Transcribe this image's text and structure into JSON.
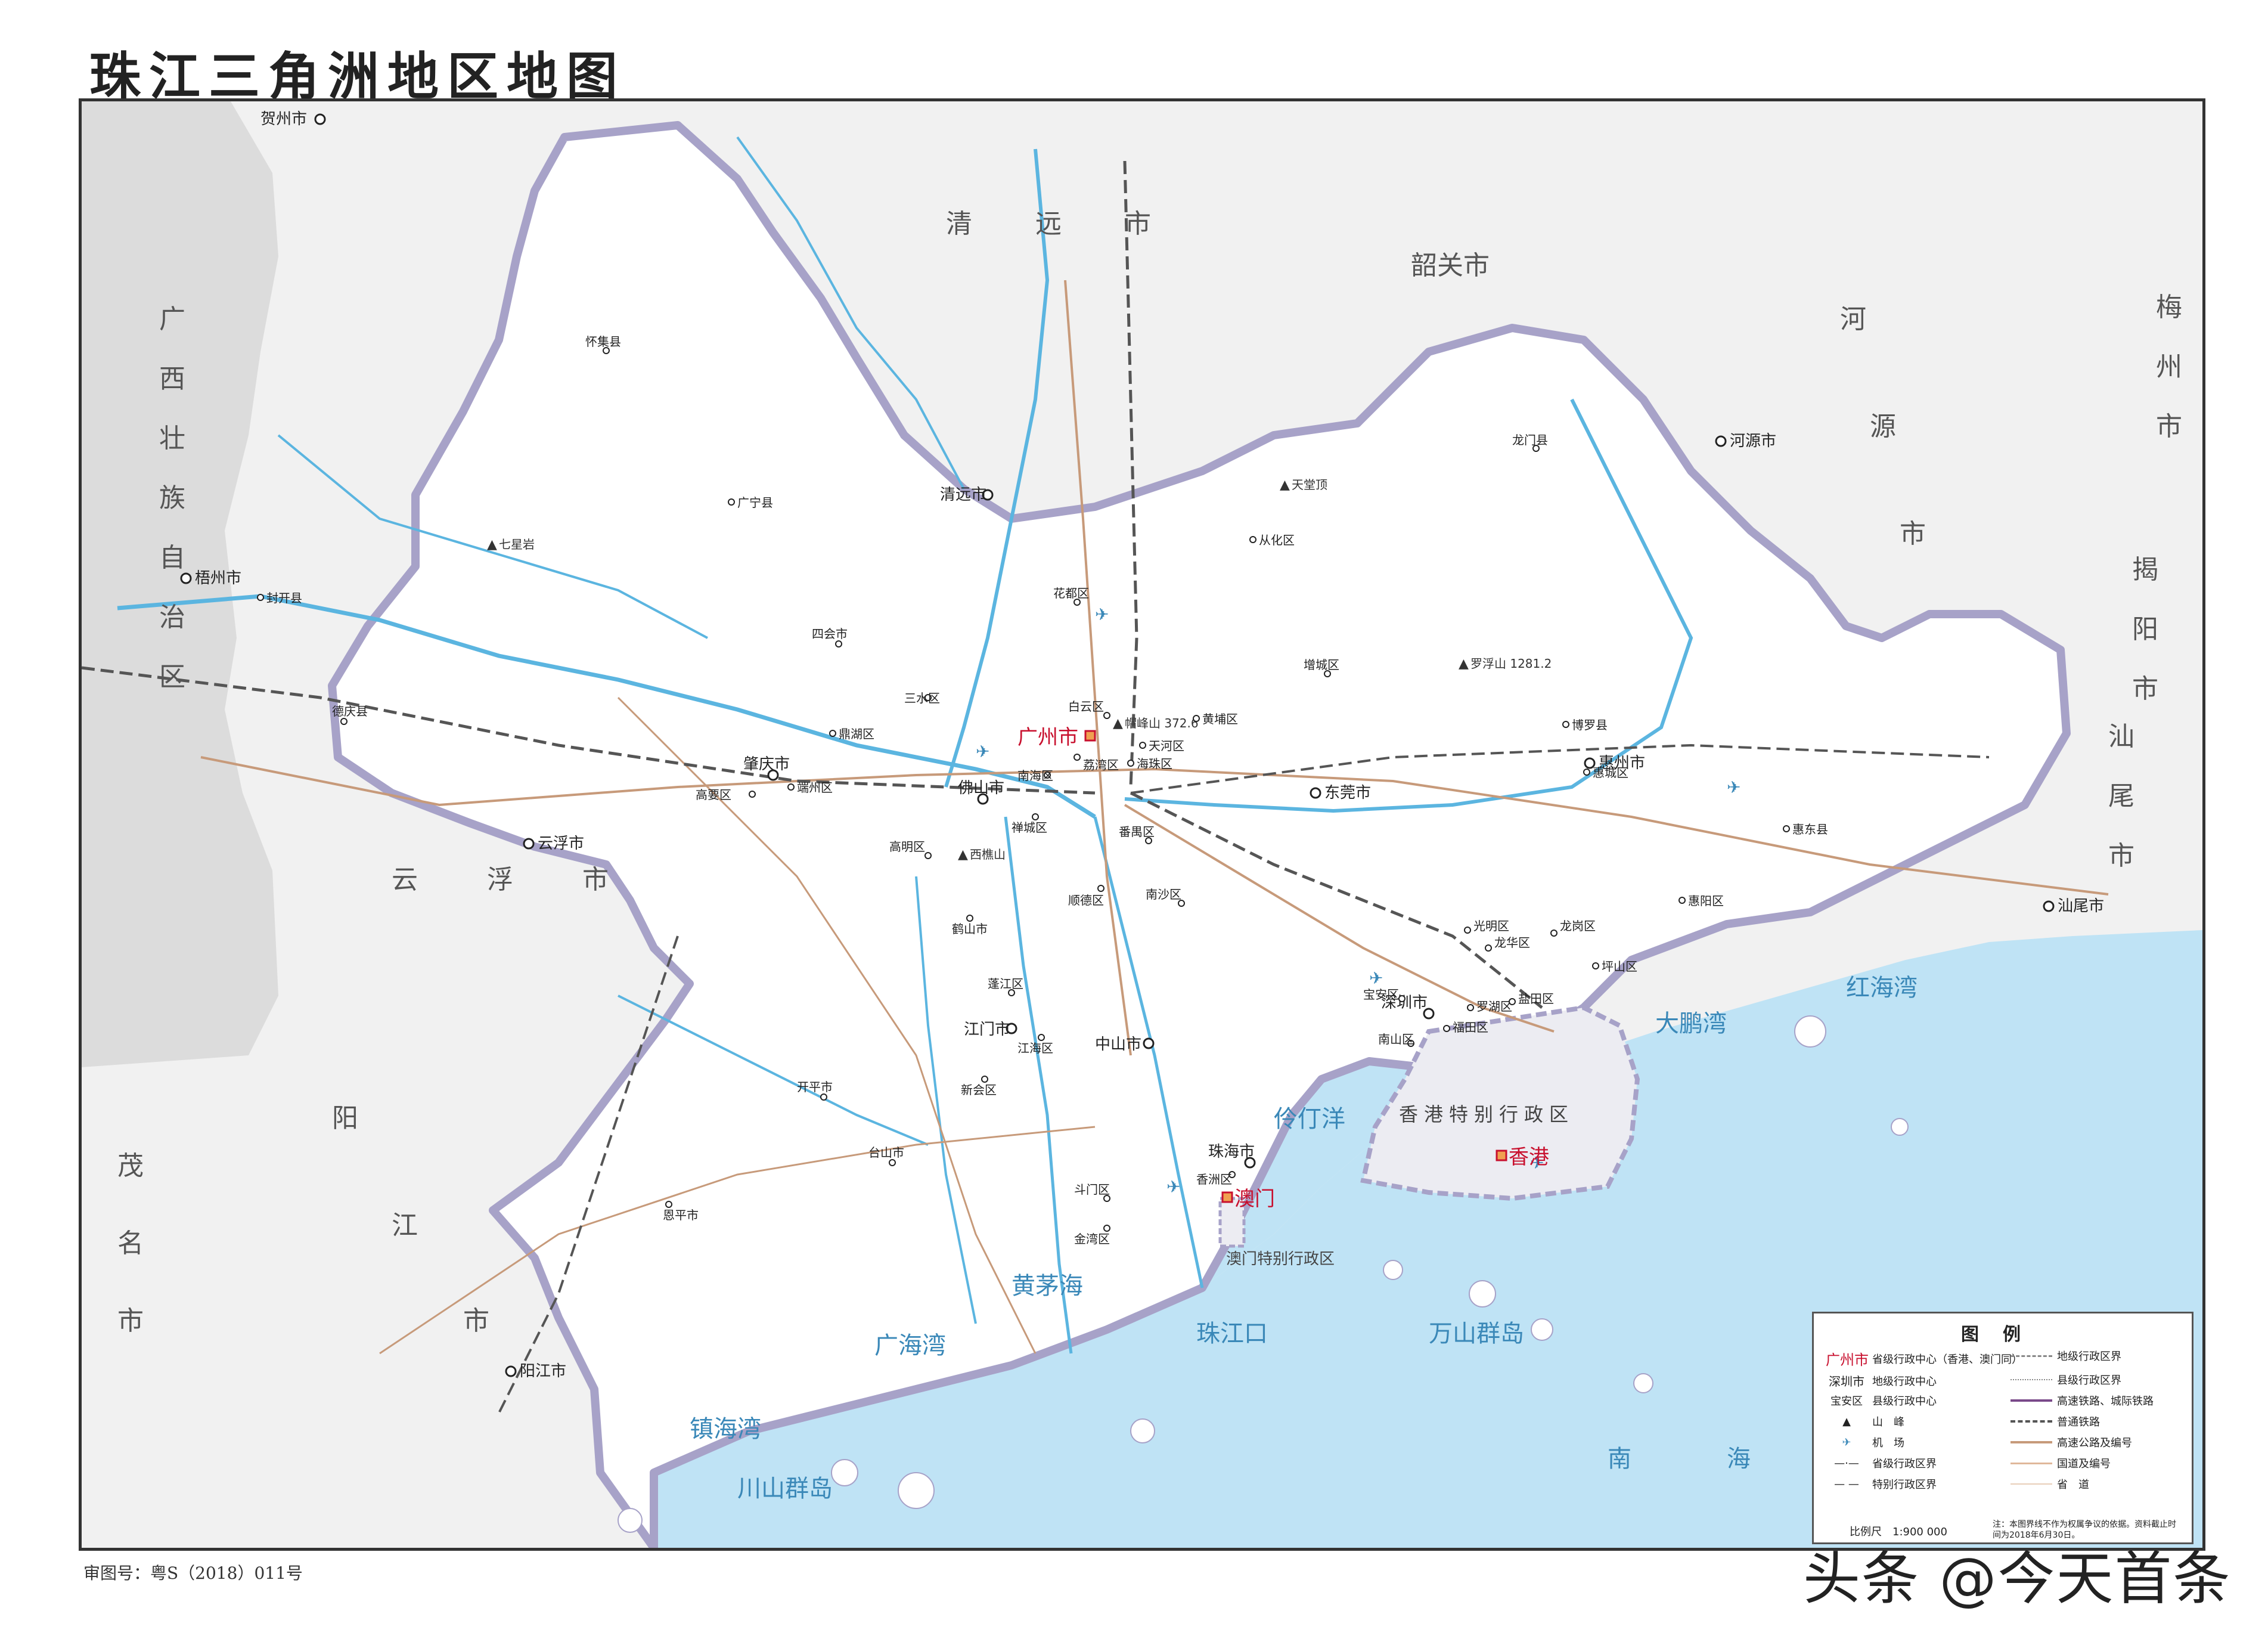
{
  "title": "珠江三角洲地区地图",
  "review_number": "审图号：粤S（2018）011号",
  "watermark": "头条 @今天首条",
  "colors": {
    "sea": "#bfe3f5",
    "region_fill": "#ffffff",
    "outside_fill": "#f1f1f1",
    "guangxi_fill": "#dcdcdc",
    "boundary": "#a7a2c8",
    "river": "#5bb5e0",
    "road": "#c79a7a",
    "rail": "#555555",
    "hk_fill": "#ececf2",
    "capital": "#c8102e"
  },
  "cities": {
    "guangzhou": "广州市",
    "shenzhen": "深圳市",
    "hongkong": "香港",
    "macau": "澳门",
    "foshan": "佛山市",
    "dongguan": "东莞市",
    "zhongshan": "中山市",
    "zhuhai": "珠海市",
    "jiangmen": "江门市",
    "zhaoqing": "肇庆市",
    "huizhou": "惠州市",
    "qingyuan": "清远市",
    "heyuan": "河源市",
    "yunfu": "云浮市",
    "wuzhou": "梧州市",
    "hezhou": "贺州市",
    "shanwei": "汕尾市",
    "yangjiang": "阳江市",
    "kaiping": "开平市",
    "taishan": "台山市",
    "enping": "恩平市",
    "sihui": "四会市",
    "huaiji": "怀集县",
    "guangning": "广宁县",
    "fengkai": "封开县",
    "deqing": "德庆县",
    "longmen": "龙门县",
    "boluo": "博罗县",
    "huidong": "惠东县",
    "conghua": "从化区",
    "huadu": "花都区",
    "baiyun": "白云区",
    "huangpu": "黄埔区",
    "zengcheng": "增城区",
    "tianhe": "天河区",
    "liwan": "荔湾区",
    "haizhu": "海珠区",
    "panyu": "番禺区",
    "nansha": "南沙区",
    "nanhai": "南海区",
    "chancheng": "禅城区",
    "sanshui": "三水区",
    "gaoming": "高明区",
    "shunde": "顺德区",
    "heshan": "鹤山市",
    "pengjiang": "蓬江区",
    "jianghai": "江海区",
    "xinhui": "新会区",
    "doumen": "斗门区",
    "jinwan": "金湾区",
    "xiangzhou": "香洲区",
    "dinghu": "鼎湖区",
    "duanzhou": "端州区",
    "gaoyao": "高要区",
    "huiyang": "惠阳区",
    "huicheng": "惠城区",
    "longgang": "龙岗区",
    "pingshan": "坪山区",
    "guangming": "光明区",
    "longhua": "龙华区",
    "baoan": "宝安区",
    "nanshan": "南山区",
    "futian": "福田区",
    "luohu": "罗湖区",
    "yantian": "盐田区"
  },
  "outside_labels": {
    "guangxi": [
      "广",
      "西",
      "壮",
      "族",
      "自",
      "治",
      "区"
    ],
    "shaoguan": "韶关市",
    "qingyuan_big": [
      "清",
      "远",
      "市"
    ],
    "heyuan_big": [
      "河",
      "源",
      "市"
    ],
    "yunfu_big": [
      "云",
      "浮",
      "市"
    ],
    "yangjiang_big": [
      "阳",
      "江",
      "市"
    ],
    "maoming_big": [
      "茂",
      "名",
      "市"
    ],
    "meizhou_big": [
      "梅",
      "州",
      "市"
    ],
    "shanwei_big": [
      "汕",
      "尾",
      "市"
    ],
    "jieyang_big": [
      "揭",
      "阳",
      "市"
    ],
    "hk_sar": "香港特别行政区",
    "macau_sar": "澳门特别行政区"
  },
  "sea_labels": {
    "south_sea": "南　　　　海",
    "pearl_mouth": "珠江口",
    "wanshan": "万山群岛",
    "chuanshan": "川山群岛",
    "lingding": "伶仃洋",
    "huangmao": "黄茅海",
    "guanghai": "广海湾",
    "zhenhai": "镇海湾",
    "honghai": "红海湾",
    "dapeng": "大鹏湾"
  },
  "peaks": {
    "baiyun_peak": "帽峰山 372.6",
    "luofu": "罗浮山 1281.2",
    "xiqiao": "西樵山",
    "qixing": "七星岩",
    "tiantang": "天堂顶"
  },
  "legend": {
    "title": "图例",
    "items": [
      {
        "symbol": "广州市",
        "label": "省级行政中心（香港、澳门同）"
      },
      {
        "symbol": "深圳市",
        "label": "地级行政中心"
      },
      {
        "symbol": "宝安区",
        "label": "县级行政中心"
      },
      {
        "symbol": "▲",
        "label": "山　峰"
      },
      {
        "symbol": "✈",
        "label": "机　场"
      },
      {
        "symbol": "—·—",
        "label": "省级行政区界"
      },
      {
        "symbol": "— —",
        "label": "特别行政区界"
      }
    ],
    "items_right": [
      {
        "label": "地级行政区界"
      },
      {
        "label": "县级行政区界"
      },
      {
        "label": "高速铁路、城际铁路"
      },
      {
        "label": "普通铁路"
      },
      {
        "label": "高速公路及编号"
      },
      {
        "label": "国道及编号"
      },
      {
        "label": "省　道"
      }
    ],
    "scale": "比例尺　1:900 000",
    "note": "注：本图界线不作为权属争议的依据。资料截止时间为2018年6月30日。"
  }
}
